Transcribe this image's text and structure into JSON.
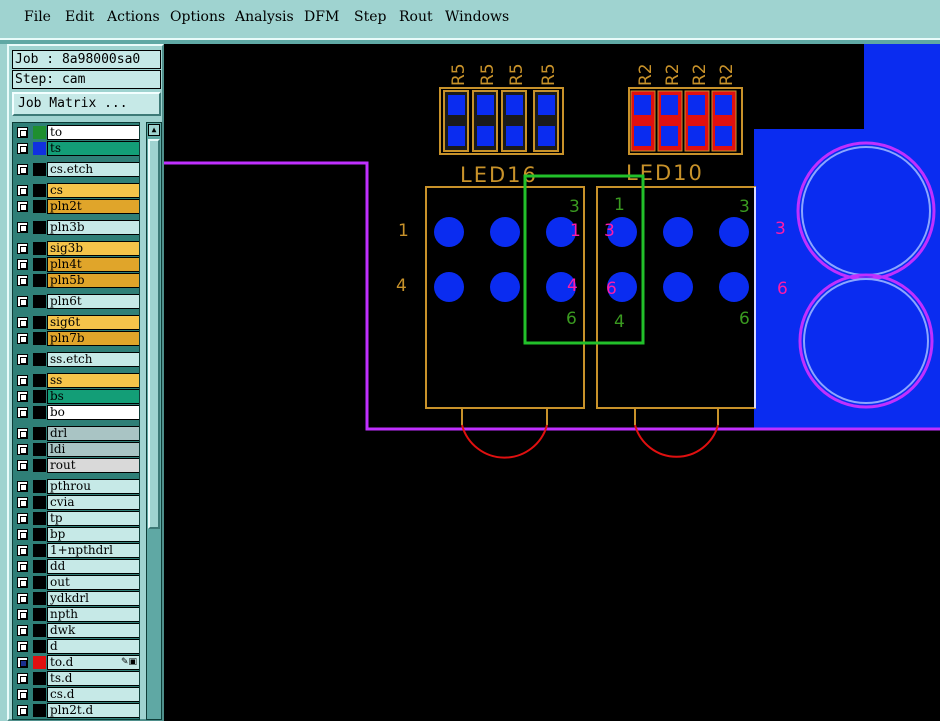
{
  "menu": {
    "file": "File",
    "edit": "Edit",
    "actions": "Actions",
    "options": "Options",
    "analysis": "Analysis",
    "dfm": "DFM",
    "step": "Step",
    "rout": "Rout",
    "windows": "Windows"
  },
  "panel": {
    "job": "Job : 8a98000sa0",
    "step": "Step: cam",
    "job_matrix": "Job Matrix ..."
  },
  "layers": [
    {
      "name": "to",
      "swatch": "#1f8f2f",
      "bg": "#ffffff",
      "checked": false
    },
    {
      "name": "ts",
      "swatch": "#1030e0",
      "bg": "#139e77",
      "checked": false
    },
    {
      "name": "cs.etch",
      "swatch": "#000000",
      "bg": "#c6e9e7",
      "checked": false
    },
    {
      "name": "cs",
      "swatch": "#000000",
      "bg": "#f5c44a",
      "checked": false
    },
    {
      "name": "pln2t",
      "swatch": "#000000",
      "bg": "#e0a52a",
      "checked": false
    },
    {
      "name": "pln3b",
      "swatch": "#000000",
      "bg": "#c6e9e7",
      "checked": false
    },
    {
      "name": "sig3b",
      "swatch": "#000000",
      "bg": "#f5c44a",
      "checked": false
    },
    {
      "name": "pln4t",
      "swatch": "#000000",
      "bg": "#e0a52a",
      "checked": false
    },
    {
      "name": "pln5b",
      "swatch": "#000000",
      "bg": "#e0a52a",
      "checked": false
    },
    {
      "name": "pln6t",
      "swatch": "#000000",
      "bg": "#c6e9e7",
      "checked": false
    },
    {
      "name": "sig6t",
      "swatch": "#000000",
      "bg": "#f5c44a",
      "checked": false
    },
    {
      "name": "pln7b",
      "swatch": "#000000",
      "bg": "#e0a52a",
      "checked": false
    },
    {
      "name": "ss.etch",
      "swatch": "#000000",
      "bg": "#c6e9e7",
      "checked": false
    },
    {
      "name": "ss",
      "swatch": "#000000",
      "bg": "#f5c44a",
      "checked": false
    },
    {
      "name": "bs",
      "swatch": "#000000",
      "bg": "#139e77",
      "checked": false
    },
    {
      "name": "bo",
      "swatch": "#000000",
      "bg": "#ffffff",
      "checked": false
    },
    {
      "name": "drl",
      "swatch": "#000000",
      "bg": "#a9c4c4",
      "checked": false
    },
    {
      "name": "ldi",
      "swatch": "#000000",
      "bg": "#a9c4c4",
      "checked": false
    },
    {
      "name": "rout",
      "swatch": "#000000",
      "bg": "#d9d9d9",
      "checked": false
    },
    {
      "name": "pthrou",
      "swatch": "#000000",
      "bg": "#c6e9e7",
      "checked": false
    },
    {
      "name": "cvia",
      "swatch": "#000000",
      "bg": "#c6e9e7",
      "checked": false
    },
    {
      "name": "tp",
      "swatch": "#000000",
      "bg": "#c6e9e7",
      "checked": false
    },
    {
      "name": "bp",
      "swatch": "#000000",
      "bg": "#c6e9e7",
      "checked": false
    },
    {
      "name": "1+npthdrl",
      "swatch": "#000000",
      "bg": "#c6e9e7",
      "checked": false
    },
    {
      "name": "dd",
      "swatch": "#000000",
      "bg": "#c6e9e7",
      "checked": false
    },
    {
      "name": "out",
      "swatch": "#000000",
      "bg": "#c6e9e7",
      "checked": false
    },
    {
      "name": "ydkdrl",
      "swatch": "#000000",
      "bg": "#c6e9e7",
      "checked": false
    },
    {
      "name": "npth",
      "swatch": "#000000",
      "bg": "#c6e9e7",
      "checked": false
    },
    {
      "name": "dwk",
      "swatch": "#000000",
      "bg": "#c6e9e7",
      "checked": false
    },
    {
      "name": "d",
      "swatch": "#000000",
      "bg": "#c6e9e7",
      "checked": false
    },
    {
      "name": "to.d",
      "swatch": "#e01010",
      "bg": "#c6e9e7",
      "checked": true
    },
    {
      "name": "ts.d",
      "swatch": "#000000",
      "bg": "#c6e9e7",
      "checked": false
    },
    {
      "name": "cs.d",
      "swatch": "#000000",
      "bg": "#c6e9e7",
      "checked": false
    },
    {
      "name": "pln2t.d",
      "swatch": "#000000",
      "bg": "#c6e9e7",
      "checked": false
    }
  ],
  "canvas": {
    "resistor_labels_left": [
      "R5",
      "R5",
      "R5",
      "R5"
    ],
    "resistor_labels_right": [
      "R2",
      "R2",
      "R2",
      "R2"
    ],
    "led_left": "LED16",
    "led_right": "LED10",
    "pins": {
      "p1": "1",
      "p4": "4",
      "p3": "3",
      "p6": "6",
      "m1": "1",
      "m3": "3",
      "m4": "4",
      "m6": "6"
    },
    "colors": {
      "pad": "#0a2cf0",
      "outline": "#c8922a",
      "route": "#c030ff",
      "green": "#22c02a",
      "pin_green": "#3a9a20",
      "magenta": "#ff1aa8",
      "red": "#e01010"
    }
  }
}
